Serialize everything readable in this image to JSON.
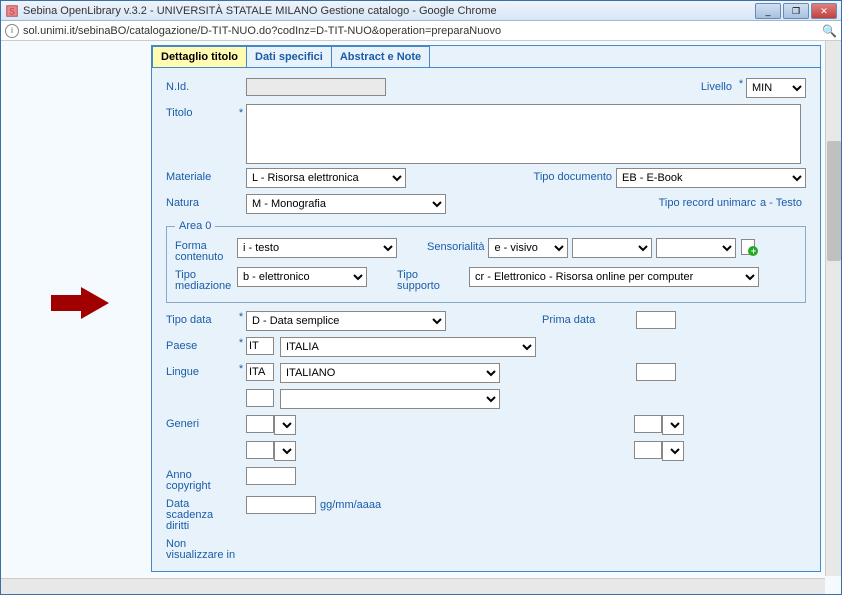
{
  "window": {
    "title": "Sebina OpenLibrary v.3.2 - UNIVERSITÀ STATALE MILANO Gestione catalogo - Google Chrome"
  },
  "addressbar": {
    "url": "sol.unimi.it/sebinaBO/catalogazione/D-TIT-NUO.do?codInz=D-TIT-NUO&operation=preparaNuovo"
  },
  "tabs": [
    {
      "label": "Dettaglio titolo",
      "active": true
    },
    {
      "label": "Dati specifici",
      "active": false
    },
    {
      "label": "Abstract e Note",
      "active": false
    }
  ],
  "fields": {
    "nid_label": "N.Id.",
    "livello_label": "Livello",
    "livello_value": "MIN",
    "titolo_label": "Titolo",
    "materiale_label": "Materiale",
    "materiale_value": "L - Risorsa elettronica",
    "tipo_documento_label": "Tipo documento",
    "tipo_documento_value": "EB - E-Book",
    "natura_label": "Natura",
    "natura_value": "M - Monografia",
    "tipo_record_label": "Tipo record unimarc",
    "tipo_record_value": "a - Testo",
    "area0_legend": "Area 0",
    "forma_contenuto_label": "Forma contenuto",
    "forma_contenuto_value": "i - testo",
    "sensorialita_label": "Sensorialità",
    "sensorialita_value": "e - visivo",
    "tipo_mediazione_label": "Tipo mediazione",
    "tipo_mediazione_value": "b - elettronico",
    "tipo_supporto_label": "Tipo supporto",
    "tipo_supporto_value": "cr - Elettronico - Risorsa online per computer",
    "tipo_data_label": "Tipo data",
    "tipo_data_value": "D - Data semplice",
    "prima_data_label": "Prima data",
    "paese_label": "Paese",
    "paese_code": "IT",
    "paese_value": "ITALIA",
    "lingue_label": "Lingue",
    "lingue_code": "ITA",
    "lingue_value": "ITALIANO",
    "generi_label": "Generi",
    "anno_copyright_label": "Anno copyright",
    "scadenza_label": "Data scadenza diritti",
    "scadenza_placeholder": "gg/mm/aaaa",
    "non_vis_label": "Non visualizzare in"
  }
}
